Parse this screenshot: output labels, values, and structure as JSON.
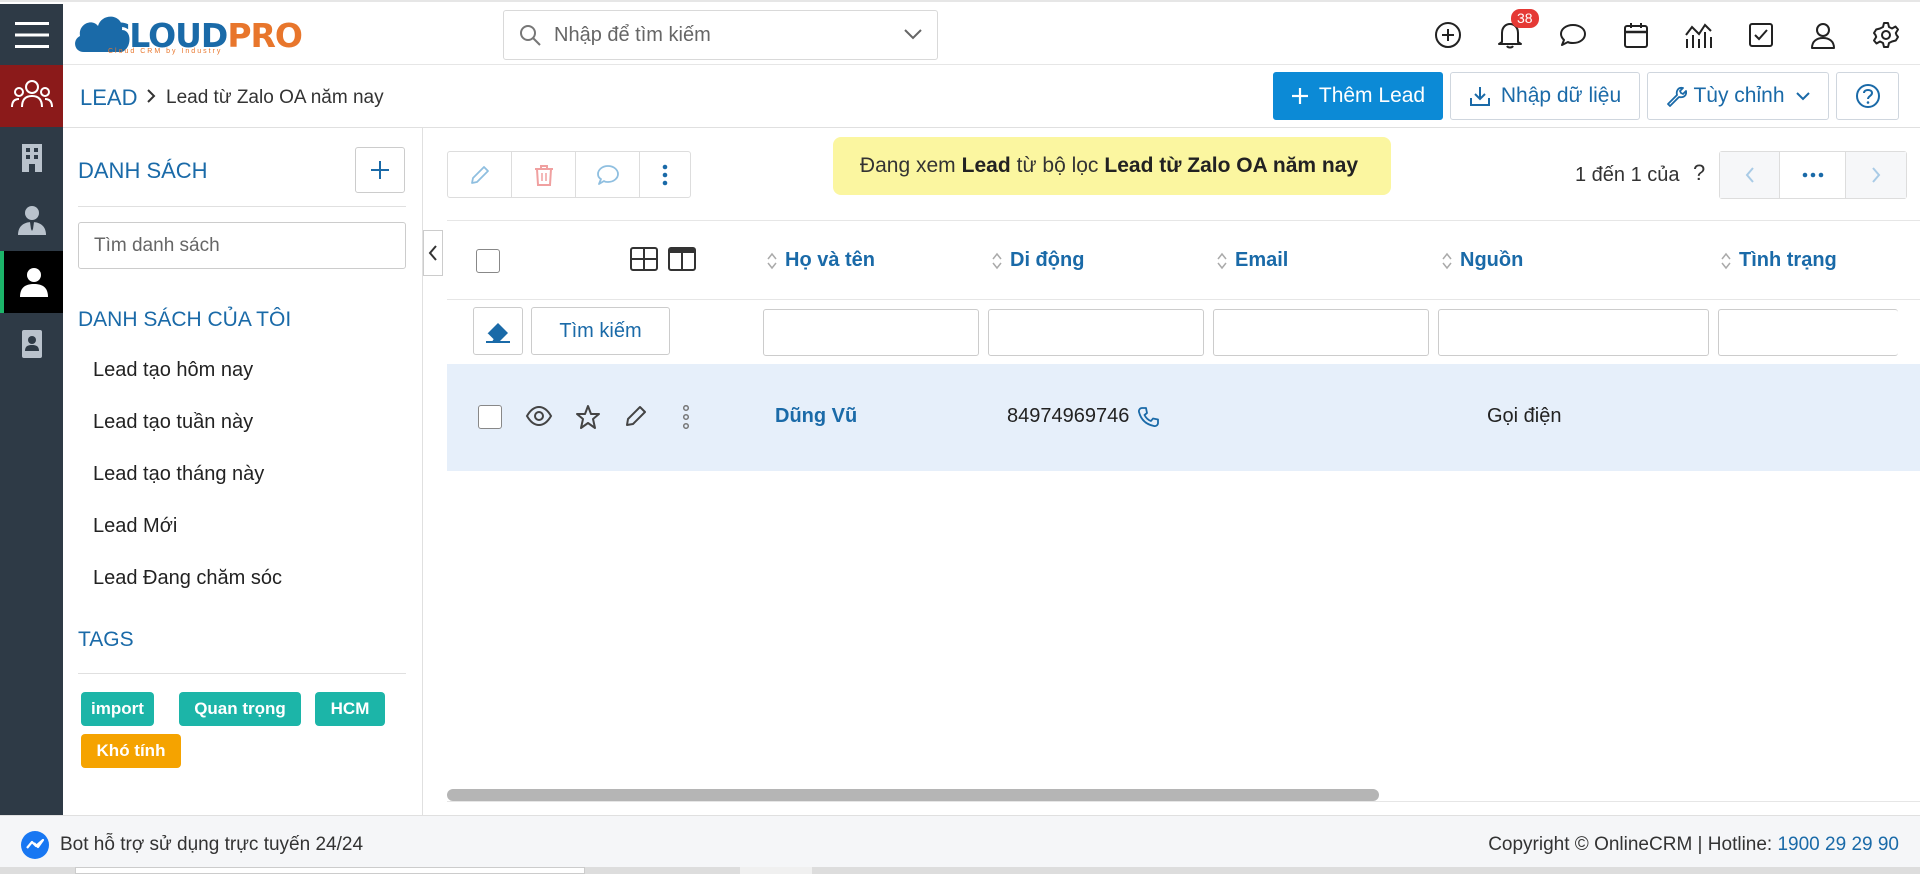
{
  "brand": {
    "name_cloud": "CLOUD",
    "name_pro": "PRO",
    "tagline": "Cloud CRM by Industry"
  },
  "search": {
    "placeholder": "Nhập để tìm kiếm"
  },
  "notifications": {
    "count": "38"
  },
  "breadcrumb": {
    "module": "LEAD",
    "current": "Lead từ Zalo OA năm nay"
  },
  "toolbar": {
    "add_label": "Thêm Lead",
    "import_label": "Nhập dữ liệu",
    "customize_label": "Tùy chỉnh"
  },
  "sidebar": {
    "title": "DANH SÁCH",
    "search_placeholder": "Tìm danh sách",
    "my_lists_title": "DANH SÁCH CỦA TÔI",
    "items": [
      {
        "label": "Lead tạo hôm nay"
      },
      {
        "label": "Lead tạo tuần này"
      },
      {
        "label": "Lead tạo tháng này"
      },
      {
        "label": "Lead Mới"
      },
      {
        "label": "Lead Đang chăm sóc"
      }
    ],
    "tags_title": "TAGS",
    "tags": [
      {
        "label": "import",
        "color": "#1cb5a8"
      },
      {
        "label": "Quan trọng",
        "color": "#1cb5a8"
      },
      {
        "label": "HCM",
        "color": "#1cb5a8"
      },
      {
        "label": "Khó tính",
        "color": "#f5a300"
      }
    ]
  },
  "filter_note": {
    "prefix": "Đang xem",
    "module": "Lead",
    "middle": "từ bộ lọc",
    "filter": "Lead từ Zalo OA năm nay"
  },
  "pagination": {
    "text": "1 đến 1 của",
    "help": "?"
  },
  "table": {
    "columns": [
      {
        "label": "Họ và tên"
      },
      {
        "label": "Di động"
      },
      {
        "label": "Email"
      },
      {
        "label": "Nguồn"
      },
      {
        "label": "Tình trạng"
      }
    ],
    "search_label": "Tìm kiếm",
    "rows": [
      {
        "name": "Dũng Vũ",
        "mobile": "84974969746",
        "email": "",
        "source": "Gọi điện",
        "status": ""
      }
    ]
  },
  "footer": {
    "bot_text": "Bot hỗ trợ sử dụng trực tuyến 24/24",
    "copyright": "Copyright © OnlineCRM",
    "hotline_label": "Hotline:",
    "hotline": "1900 29 29 90"
  },
  "colors": {
    "accent": "#1a6aa8",
    "primary_button": "#0c8ad6",
    "sidebar_dark": "#2e3a46",
    "active_nav": "#8b1a1a",
    "row_highlight": "#e6effa",
    "filter_note_bg": "#fbf6a0"
  }
}
